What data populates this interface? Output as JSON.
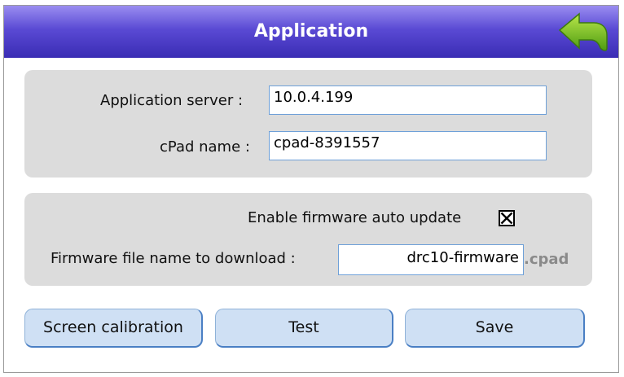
{
  "header": {
    "title": "Application",
    "back_icon": "green-back-arrow-icon"
  },
  "server_section": {
    "app_server_label": "Application server :",
    "app_server_value": "10.0.4.199",
    "cpad_name_label": "cPad name :",
    "cpad_name_value": "cpad-8391557"
  },
  "firmware_section": {
    "auto_update_label": "Enable firmware auto update",
    "auto_update_checked": true,
    "file_name_label": "Firmware file name to download :",
    "file_name_value": "drc10-firmware",
    "file_suffix": ".cpad"
  },
  "buttons": {
    "calibration_label": "Screen calibration",
    "test_label": "Test",
    "save_label": "Save"
  },
  "colors": {
    "header_top": "#9a8df0",
    "header_bottom": "#3a2cb4",
    "panel_bg": "#dcdcdc",
    "button_bg": "#cfe0f4",
    "field_border": "#6ea0d8"
  }
}
